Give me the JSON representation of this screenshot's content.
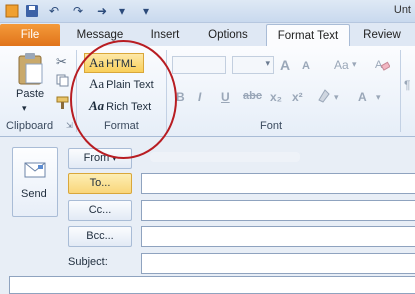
{
  "window": {
    "title": "Unt"
  },
  "quick_access": {
    "icons": [
      "outlook-icon",
      "save-icon",
      "undo-icon",
      "redo-icon",
      "forward-icon",
      "customize-icon"
    ]
  },
  "tabs": [
    {
      "label": "File"
    },
    {
      "label": "Message"
    },
    {
      "label": "Insert"
    },
    {
      "label": "Options"
    },
    {
      "label": "Format Text"
    },
    {
      "label": "Review"
    }
  ],
  "ribbon": {
    "clipboard": {
      "paste_label": "Paste",
      "group_label": "Clipboard"
    },
    "format": {
      "group_label": "Format",
      "options": [
        {
          "glyph": "Aa",
          "label": "HTML"
        },
        {
          "glyph": "Aa",
          "label": "Plain Text"
        },
        {
          "glyph": "Aa",
          "label": "Rich Text"
        }
      ]
    },
    "font": {
      "group_label": "Font",
      "buttons": [
        "B",
        "I",
        "U",
        "abc",
        "x₂",
        "x²"
      ],
      "grow_glyph": "A",
      "shrink_glyph": "A",
      "case_glyph": "Aa"
    }
  },
  "compose": {
    "send_label": "Send",
    "from_label": "From",
    "to_label": "To...",
    "cc_label": "Cc...",
    "bcc_label": "Bcc...",
    "subject_label": "Subject:",
    "to_value": "",
    "cc_value": "",
    "bcc_value": "",
    "subject_value": ""
  },
  "colors": {
    "file_tab": "#e0741b",
    "highlight_ring": "#b81d22",
    "selected_format": "#f9cf5a"
  }
}
